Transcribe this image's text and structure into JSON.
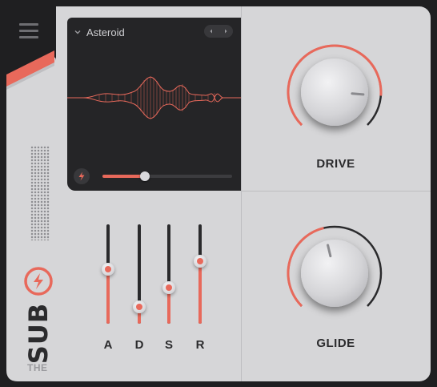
{
  "menu": {
    "icon": "hamburger-menu-icon"
  },
  "brand": {
    "logo_icon": "bolt-logo-icon",
    "name": "SUB",
    "prefix": "THE",
    "accent": "#e8695b"
  },
  "screen": {
    "preset": "Asteroid",
    "preset_dropdown_icon": "chevron-down-icon",
    "prev_icon": "chevron-left-icon",
    "next_icon": "chevron-right-icon",
    "mode_icon": "bolt-icon",
    "mix_value": 0.33
  },
  "envelope": {
    "faders": [
      {
        "label": "A",
        "value": 0.55
      },
      {
        "label": "D",
        "value": 0.17
      },
      {
        "label": "S",
        "value": 0.36
      },
      {
        "label": "R",
        "value": 0.63
      }
    ]
  },
  "drive": {
    "label": "DRIVE",
    "value": 0.85
  },
  "glide": {
    "label": "GLIDE",
    "value": 0.45
  },
  "colors": {
    "accent": "#e8695b",
    "panel": "#d6d6d8",
    "screen": "#252527",
    "frame": "#1f1f21"
  }
}
